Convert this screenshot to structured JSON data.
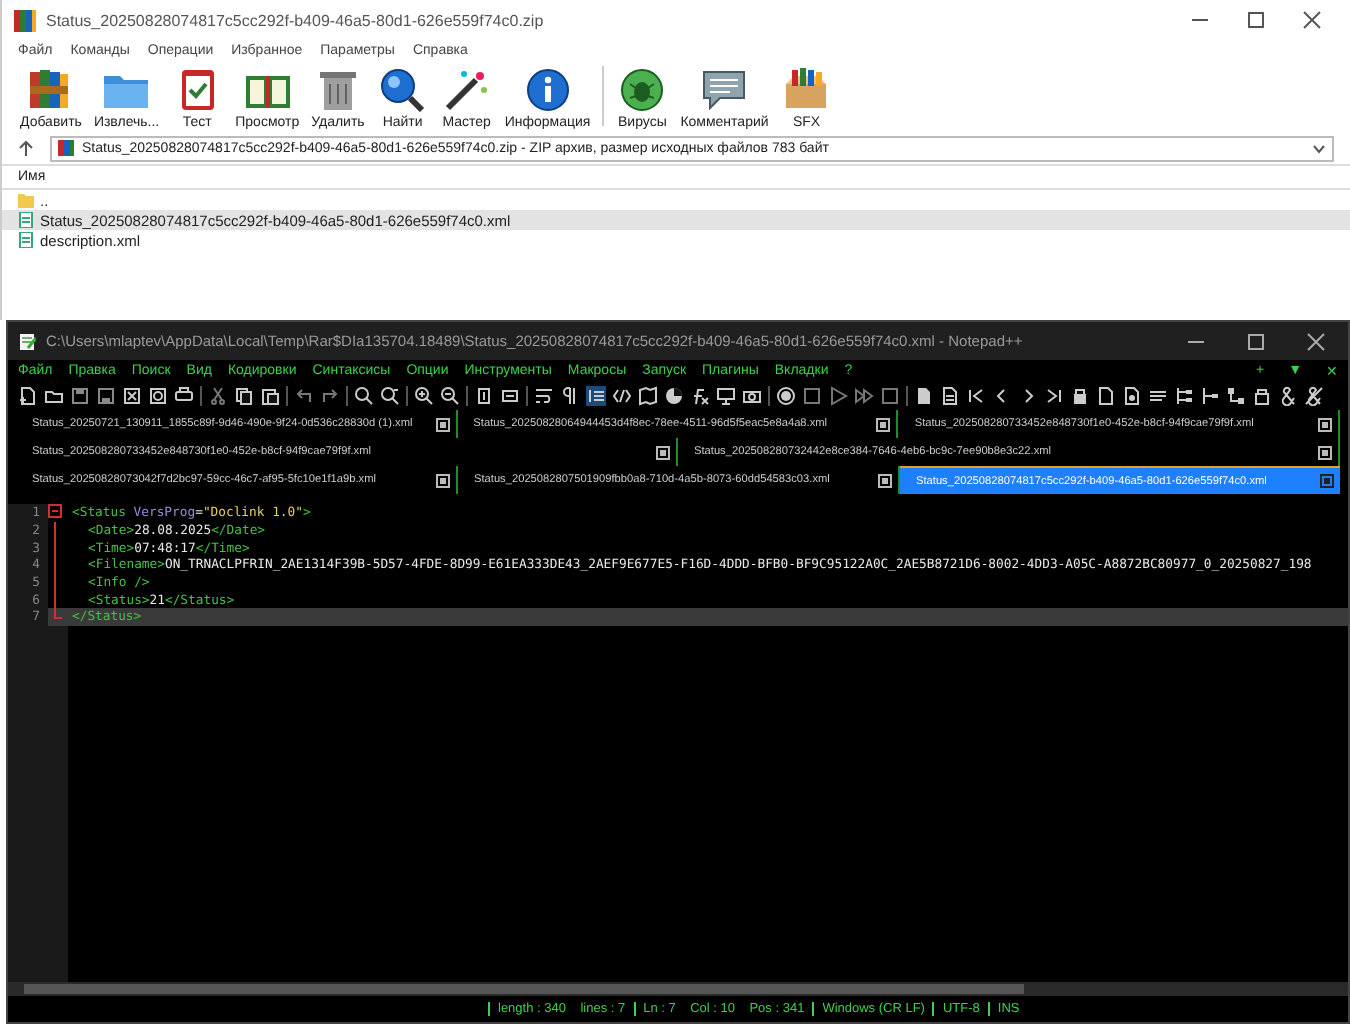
{
  "winrar": {
    "title": "Status_20250828074817c5cc292f-b409-46a5-80d1-626e559f74c0.zip",
    "menu": [
      "Файл",
      "Команды",
      "Операции",
      "Избранное",
      "Параметры",
      "Справка"
    ],
    "toolbar": [
      {
        "kind": "add",
        "label": "Добавить"
      },
      {
        "kind": "extract",
        "label": "Извлечь..."
      },
      {
        "kind": "test",
        "label": "Тест"
      },
      {
        "kind": "view",
        "label": "Просмотр"
      },
      {
        "kind": "delete",
        "label": "Удалить"
      },
      {
        "kind": "find",
        "label": "Найти"
      },
      {
        "kind": "wizard",
        "label": "Мастер"
      },
      {
        "kind": "info",
        "label": "Информация"
      },
      {
        "kind": "virus",
        "label": "Вирусы"
      },
      {
        "kind": "comment",
        "label": "Комментарий"
      },
      {
        "kind": "sfx",
        "label": "SFX"
      }
    ],
    "address": "Status_20250828074817c5cc292f-b409-46a5-80d1-626e559f74c0.zip - ZIP архив, размер исходных файлов 783 байт",
    "column": "Имя",
    "files": [
      {
        "kind": "parent",
        "name": "..",
        "selected": false
      },
      {
        "kind": "xml",
        "name": "Status_20250828074817c5cc292f-b409-46a5-80d1-626e559f74c0.xml",
        "selected": true
      },
      {
        "kind": "xml",
        "name": "description.xml",
        "selected": false
      }
    ]
  },
  "notepad": {
    "title": "C:\\Users\\mlaptev\\AppData\\Local\\Temp\\Rar$DIa135704.18489\\Status_20250828074817c5cc292f-b409-46a5-80d1-626e559f74c0.xml - Notepad++",
    "menu": [
      "Файл",
      "Правка",
      "Поиск",
      "Вид",
      "Кодировки",
      "Синтаксисы",
      "Опции",
      "Инструменты",
      "Макросы",
      "Запуск",
      "Плагины",
      "Вкладки",
      "?"
    ],
    "menu_right": [
      "+",
      "▼",
      "✕"
    ],
    "tab_rows": [
      [
        {
          "label": "Status_20250721_130911_1855c89f-9d46-490e-9f24-0d536c28830d (1).xml",
          "selected": false
        },
        {
          "label": "Status_20250828064944453d4f8ec-78ee-4511-96d5f5eac5e8a4a8.xml",
          "selected": false
        },
        {
          "label": "Status_202508280733452e848730f1e0-452e-b8cf-94f9cae79f9f.xml",
          "selected": false
        }
      ],
      [
        {
          "label": "Status_202508280733452e848730f1e0-452e-b8cf-94f9cae79f9f.xml",
          "selected": false
        },
        {
          "label": "Status_202508280732442e8ce384-7646-4eb6-bc9c-7ee90b8e3c22.xml",
          "selected": false
        }
      ],
      [
        {
          "label": "Status_20250828073042f7d2bc97-59cc-46c7-af95-5fc10e1f1a9b.xml",
          "selected": false
        },
        {
          "label": "Status_2025082807501909fbb0a8-710d-4a5b-8073-60dd54583c03.xml",
          "selected": false
        },
        {
          "label": "Status_20250828074817c5cc292f-b409-46a5-80d1-626e559f74c0.xml",
          "selected": true
        }
      ]
    ],
    "lines": [
      {
        "number": "1",
        "kind": "fold-start",
        "current": false,
        "tokens": [
          {
            "kind": "tag",
            "text": "<Status"
          },
          {
            "kind": "attr",
            "text": " VersProg"
          },
          {
            "kind": "text",
            "text": "="
          },
          {
            "kind": "value",
            "text": "\"Doclink 1.0\""
          },
          {
            "kind": "tag",
            "text": ">"
          }
        ]
      },
      {
        "number": "2",
        "kind": "inner",
        "current": false,
        "tokens": [
          {
            "kind": "tag",
            "text": "<Date>"
          },
          {
            "kind": "text",
            "text": "28.08.2025"
          },
          {
            "kind": "tag",
            "text": "</Date>"
          }
        ]
      },
      {
        "number": "3",
        "kind": "inner",
        "current": false,
        "tokens": [
          {
            "kind": "tag",
            "text": "<Time>"
          },
          {
            "kind": "text",
            "text": "07:48:17"
          },
          {
            "kind": "tag",
            "text": "</Time>"
          }
        ]
      },
      {
        "number": "4",
        "kind": "inner",
        "current": false,
        "tokens": [
          {
            "kind": "tag",
            "text": "<Filename>"
          },
          {
            "kind": "text",
            "text": "ON_TRNACLPFRIN_2AE1314F39B-5D57-4FDE-8D99-E61EA333DE43_2AEF9E677E5-F16D-4DDD-BFB0-BF9C95122A0C_2AE5B8721D6-8002-4DD3-A05C-A8872BC80977_0_20250827_198"
          }
        ]
      },
      {
        "number": "5",
        "kind": "inner",
        "current": false,
        "tokens": [
          {
            "kind": "tag",
            "text": "<Info />"
          }
        ]
      },
      {
        "number": "6",
        "kind": "inner",
        "current": false,
        "tokens": [
          {
            "kind": "tag",
            "text": "<Status>"
          },
          {
            "kind": "text",
            "text": "21"
          },
          {
            "kind": "tag",
            "text": "</Status>"
          }
        ]
      },
      {
        "number": "7",
        "kind": "fold-end",
        "current": true,
        "tokens": [
          {
            "kind": "tag",
            "text": "</Status>"
          }
        ]
      }
    ],
    "status_bar": [
      "length : 340    lines : 7",
      "Ln : 7    Col : 10    Pos : 341",
      "Windows (CR LF)",
      "UTF-8",
      "INS"
    ]
  }
}
